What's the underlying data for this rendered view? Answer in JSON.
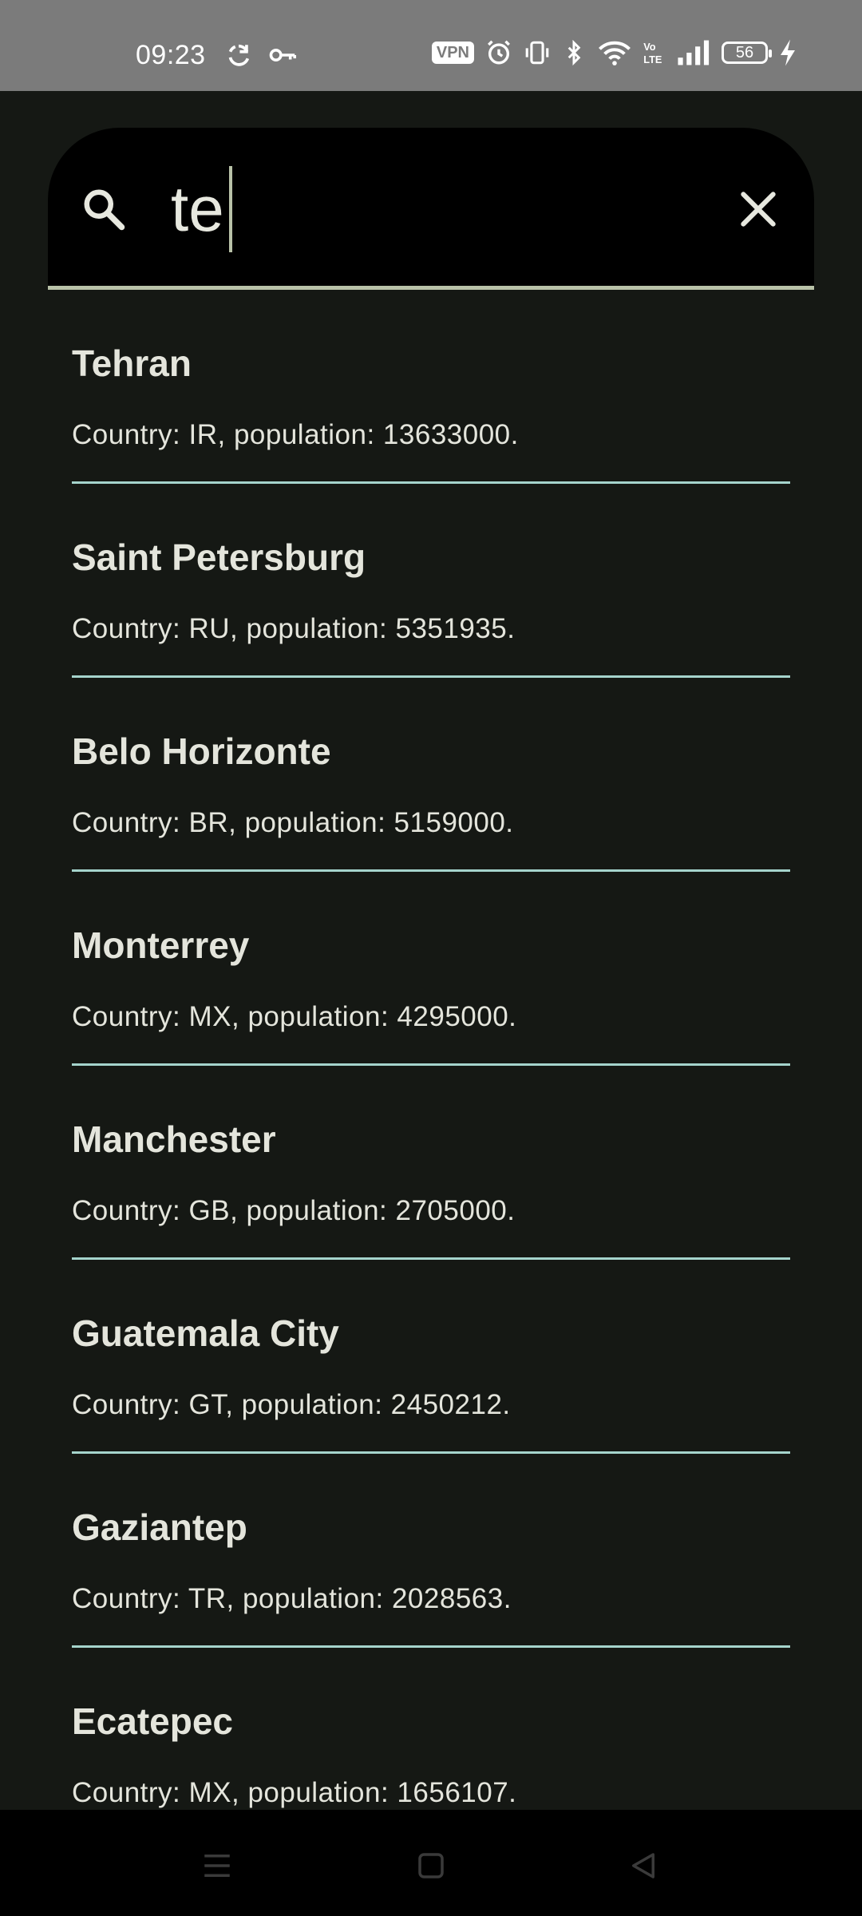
{
  "status_bar": {
    "time": "09:23",
    "vpn_label": "VPN",
    "battery_level": "56",
    "icons": [
      "sync-icon",
      "key-icon",
      "vpn-icon",
      "alarm-icon",
      "vibrate-icon",
      "bluetooth-icon",
      "wifi-icon",
      "volte-icon",
      "signal-icon",
      "battery-icon",
      "charging-icon"
    ]
  },
  "search": {
    "query": "te",
    "icon": "search-icon",
    "clear_icon": "close-icon"
  },
  "results": [
    {
      "name": "Tehran",
      "detail": "Country: IR, population: 13633000."
    },
    {
      "name": "Saint Petersburg",
      "detail": "Country: RU, population: 5351935."
    },
    {
      "name": "Belo Horizonte",
      "detail": "Country: BR, population: 5159000."
    },
    {
      "name": "Monterrey",
      "detail": "Country: MX, population: 4295000."
    },
    {
      "name": "Manchester",
      "detail": "Country: GB, population: 2705000."
    },
    {
      "name": "Guatemala City",
      "detail": "Country: GT, population: 2450212."
    },
    {
      "name": "Gaziantep",
      "detail": "Country: TR, population: 2028563."
    },
    {
      "name": "Ecatepec",
      "detail": "Country: MX, population: 1656107."
    }
  ],
  "nav_bar": {
    "icons": [
      "menu-icon",
      "home-icon",
      "back-icon"
    ]
  },
  "colors": {
    "background": "#151814",
    "status_bar": "#7b7b7b",
    "search_background": "#000000",
    "search_underline": "#b9c2a8",
    "text": "#e4e5dc",
    "divider": "#a5d4cc"
  }
}
